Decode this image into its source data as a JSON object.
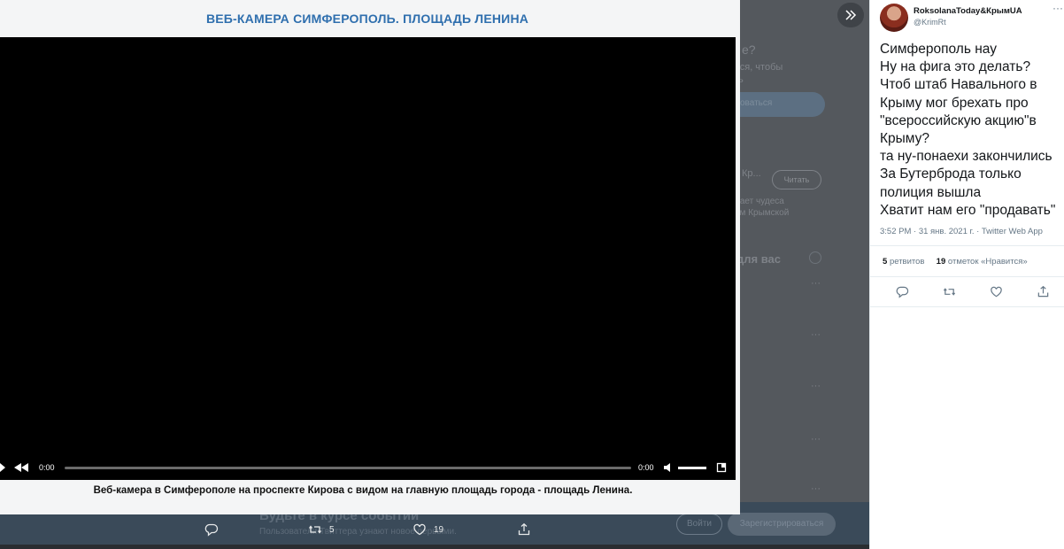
{
  "media": {
    "title": "ВЕБ-КАМЕРА СИМФЕРОПОЛЬ. ПЛОЩАДЬ ЛЕНИНА",
    "caption": "Веб-камера в Симферополе на проспекте Кирова с видом на главную площадь города - площадь Ленина.",
    "player": {
      "current_time": "0:00",
      "duration": "0:00",
      "progress": 0,
      "volume": 0.85
    }
  },
  "background": {
    "snippets": [
      {
        "id": "s1",
        "text": "e?"
      },
      {
        "id": "s2",
        "text": "ься, чтобы"
      },
      {
        "id": "s3",
        "text": "ь"
      },
      {
        "id": "s4",
        "text": "оваться"
      },
      {
        "id": "s5",
        "text": "Кр..."
      },
      {
        "id": "s6",
        "text": "дает чудеса"
      },
      {
        "id": "s7",
        "text": "ем Крымской"
      },
      {
        "id": "s8",
        "text": "для вас"
      }
    ],
    "read_button": "Читать",
    "bottom_title": "Будьте в курсе событий",
    "bottom_sub": "Пользователи Твиттера узнают новое первыми.",
    "login_button": "Войти",
    "signup_button": "Зарегистрироваться"
  },
  "media_actions": {
    "retweets": "5",
    "likes": "19"
  },
  "tweet": {
    "author_name": "RoksolanaToday&КрымUA",
    "author_handle": "@KrimRt",
    "lines": [
      "Симферополь нау",
      "Ну на фига это делать?",
      "Чтоб штаб Навального в",
      "Крыму мог брехать про",
      "\"всероссийскую акцию\"в",
      "Крыму?",
      "та ну-понаехи закончились",
      "За Бутерброда только",
      "полиция вышла",
      "Хватит нам его \"продавать\""
    ],
    "meta": "3:52 PM · 31 янв. 2021 г. · Twitter Web App",
    "retweets_count": "5",
    "retweets_label": "ретвитов",
    "likes_count": "19",
    "likes_label": "отметок «Нравится»"
  }
}
